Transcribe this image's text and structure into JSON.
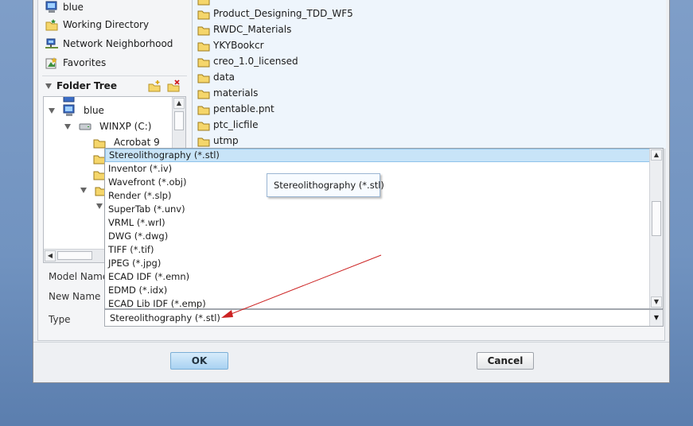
{
  "nav": {
    "items": [
      {
        "label": "blue",
        "icon": "computer-icon"
      },
      {
        "label": "Working Directory",
        "icon": "working-directory-icon"
      },
      {
        "label": "Network Neighborhood",
        "icon": "network-icon"
      },
      {
        "label": "Favorites",
        "icon": "favorites-icon"
      }
    ]
  },
  "tree": {
    "title": "Folder Tree",
    "nodes": [
      {
        "label": "blue",
        "icon": "computer-icon"
      },
      {
        "label": "WINXP (C:)",
        "icon": "drive-icon"
      },
      {
        "label": "Acrobat 9",
        "icon": "folder-icon"
      }
    ]
  },
  "files": [
    "Product_Designing_TDD_WF5",
    "RWDC_Materials",
    "YKYBookcr",
    "creo_1.0_licensed",
    "data",
    "materials",
    "pentable.pnt",
    "ptc_licfile",
    "utmp"
  ],
  "form": {
    "model_name_label": "Model Name",
    "new_name_label": "New Name",
    "type_label": "Type",
    "type_value": "Stereolithography (*.stl)"
  },
  "type_options": [
    "Stereolithography (*.stl)",
    "Inventor (*.iv)",
    "Wavefront (*.obj)",
    "Render (*.slp)",
    "SuperTab (*.unv)",
    "VRML (*.wrl)",
    "DWG (*.dwg)",
    "TIFF (*.tif)",
    "JPEG (*.jpg)",
    "ECAD IDF (*.emn)",
    "EDMD (*.idx)",
    "ECAD Lib IDF (*.emp)"
  ],
  "tooltip": "Stereolithography (*.stl)",
  "buttons": {
    "ok": "OK",
    "cancel": "Cancel"
  },
  "colors": {
    "accent": "#c8e4f8",
    "annotation_arrow": "#cc2222",
    "file_pane_bg": "#eef5fc"
  }
}
